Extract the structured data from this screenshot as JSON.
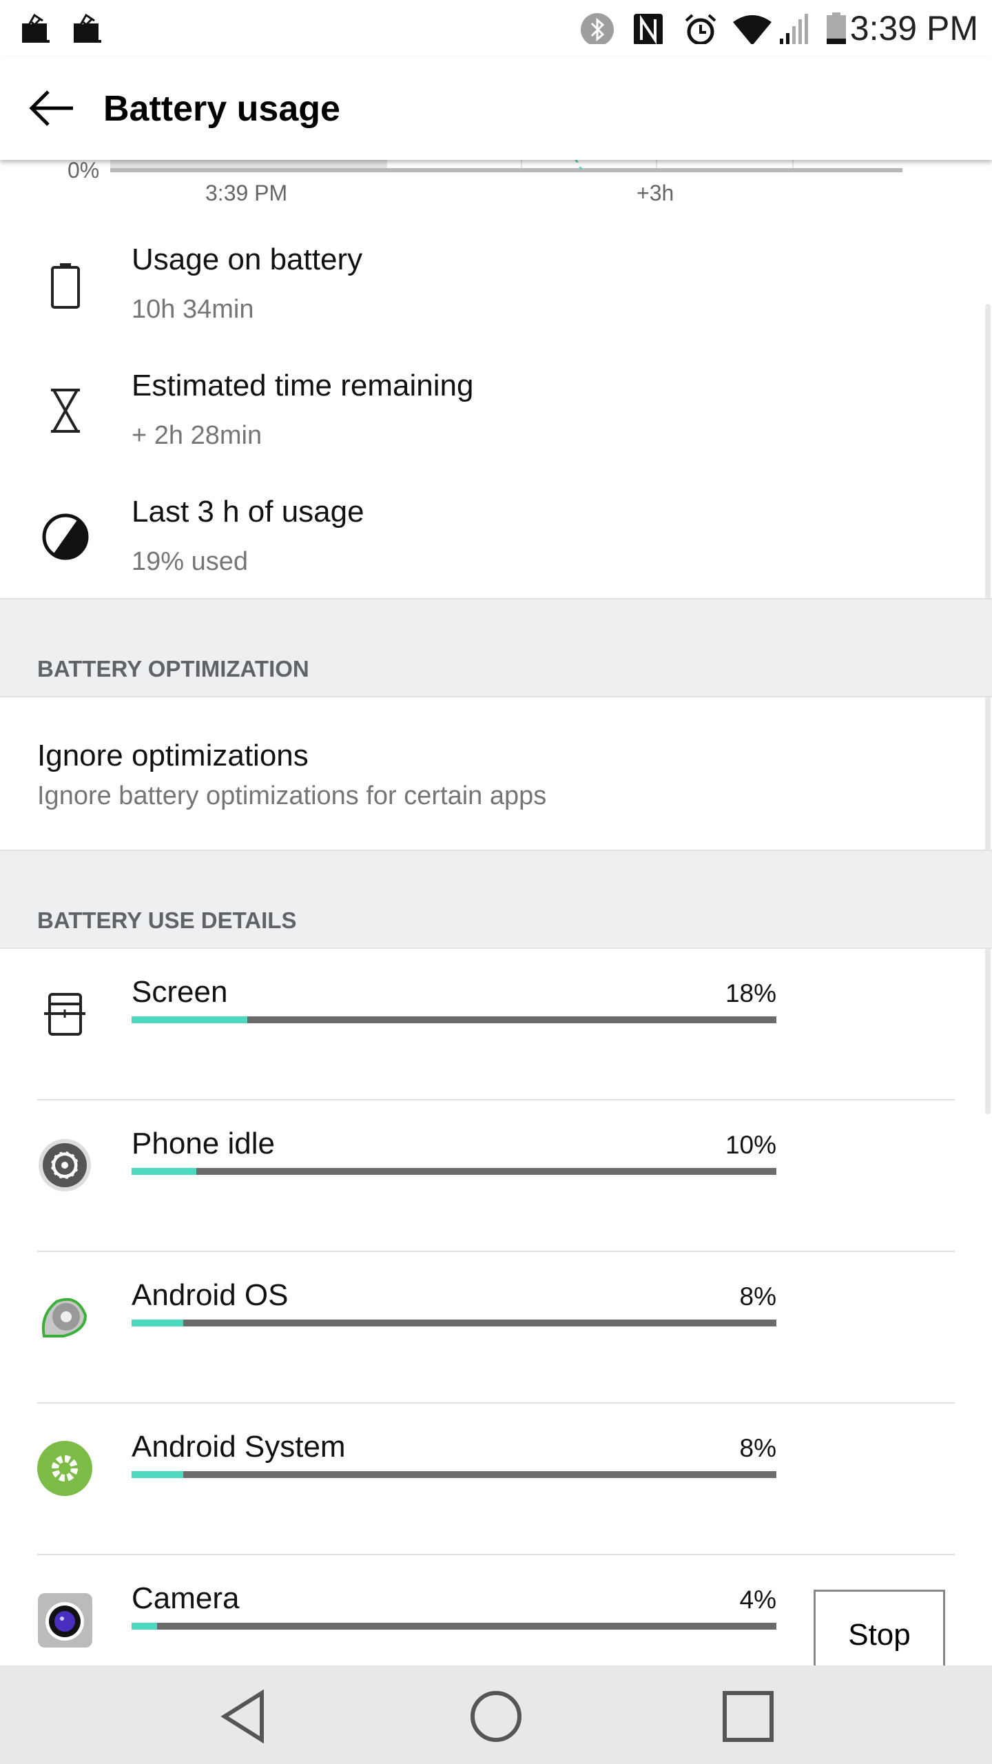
{
  "status_bar": {
    "time": "3:39 PM",
    "icons": [
      "notification-mail-icon",
      "notification-mail-icon",
      "bluetooth-icon",
      "nfc-icon",
      "alarm-icon",
      "wifi-icon",
      "signal-icon",
      "battery-icon"
    ]
  },
  "header": {
    "title": "Battery usage",
    "back_icon": "arrow-left-icon"
  },
  "graph": {
    "y_label": "0%",
    "x_labels": [
      "3:39 PM",
      "+3h"
    ],
    "accent": "#4dd9bf"
  },
  "summary": [
    {
      "icon": "battery-outline-icon",
      "title": "Usage on battery",
      "subtitle": "10h 34min"
    },
    {
      "icon": "hourglass-icon",
      "title": "Estimated time remaining",
      "subtitle": "+ 2h 28min"
    },
    {
      "icon": "pie-half-icon",
      "title": "Last 3 h of usage",
      "subtitle": "19% used"
    }
  ],
  "optimization": {
    "header": "BATTERY OPTIMIZATION",
    "title": "Ignore optimizations",
    "subtitle": "Ignore battery optimizations for certain apps"
  },
  "details": {
    "header": "BATTERY USE DETAILS",
    "items": [
      {
        "name": "Screen",
        "percent": "18%",
        "value": 18,
        "icon": "screen-icon"
      },
      {
        "name": "Phone idle",
        "percent": "10%",
        "value": 10,
        "icon": "gear-icon"
      },
      {
        "name": "Android OS",
        "percent": "8%",
        "value": 8,
        "icon": "android-os-icon"
      },
      {
        "name": "Android System",
        "percent": "8%",
        "value": 8,
        "icon": "android-system-icon"
      },
      {
        "name": "Camera",
        "percent": "4%",
        "value": 4,
        "icon": "camera-icon"
      }
    ],
    "stop_label": "Stop"
  },
  "colors": {
    "bar_fill": "#4dd9bf",
    "bar_track": "#6b6b6b",
    "section_bg": "#eeeff0"
  }
}
